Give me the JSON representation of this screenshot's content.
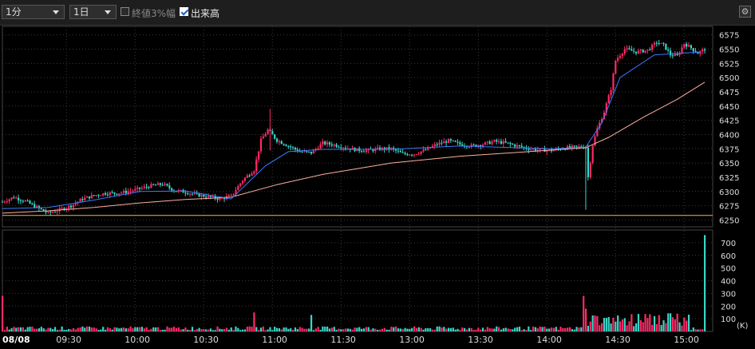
{
  "toolbar": {
    "interval": "1分",
    "period": "1日",
    "closing_pct_label": "終値3%幅",
    "closing_pct_checked": false,
    "volume_label": "出来高",
    "volume_checked": true,
    "settings_icon": "gear-icon"
  },
  "colors": {
    "up": "#ff2a66",
    "down": "#39d6c8",
    "ma_short": "#3a7bff",
    "ma_long": "#ffb0a0",
    "prev_close": "#e6b85a",
    "grid": "#3a3a3a",
    "background": "#000000"
  },
  "chart_data": [
    {
      "type": "candlestick",
      "date_label": "08/08",
      "x_ticks": [
        "09:30",
        "10:00",
        "10:30",
        "11:00",
        "11:30",
        "13:00",
        "13:30",
        "14:00",
        "14:30",
        "15:00"
      ],
      "y_ticks": [
        6250,
        6275,
        6300,
        6325,
        6350,
        6375,
        6400,
        6425,
        6450,
        6475,
        6500,
        6525,
        6550,
        6575
      ],
      "ylim": [
        6238,
        6590
      ],
      "prev_close": 6258,
      "series": [
        {
          "name": "price",
          "points": [
            [
              0,
              6282
            ],
            [
              5,
              6290
            ],
            [
              10,
              6283
            ],
            [
              15,
              6272
            ],
            [
              20,
              6262
            ],
            [
              25,
              6268
            ],
            [
              30,
              6275
            ],
            [
              35,
              6287
            ],
            [
              40,
              6293
            ],
            [
              45,
              6297
            ],
            [
              50,
              6297
            ],
            [
              55,
              6300
            ],
            [
              60,
              6305
            ],
            [
              65,
              6310
            ],
            [
              70,
              6313
            ],
            [
              75,
              6302
            ],
            [
              80,
              6299
            ],
            [
              85,
              6294
            ],
            [
              90,
              6291
            ],
            [
              95,
              6287
            ],
            [
              100,
              6292
            ],
            [
              105,
              6320
            ],
            [
              110,
              6338
            ],
            [
              113,
              6390
            ],
            [
              116,
              6408
            ],
            [
              120,
              6390
            ],
            [
              125,
              6380
            ],
            [
              130,
              6370
            ],
            [
              135,
              6368
            ],
            [
              140,
              6385
            ],
            [
              145,
              6382
            ],
            [
              150,
              6377
            ],
            [
              155,
              6373
            ],
            [
              160,
              6372
            ],
            [
              165,
              6375
            ],
            [
              170,
              6375
            ],
            [
              175,
              6366
            ],
            [
              180,
              6366
            ],
            [
              185,
              6373
            ],
            [
              190,
              6383
            ],
            [
              195,
              6389
            ],
            [
              200,
              6383
            ],
            [
              205,
              6380
            ],
            [
              210,
              6383
            ],
            [
              215,
              6388
            ],
            [
              220,
              6385
            ],
            [
              225,
              6380
            ],
            [
              230,
              6375
            ],
            [
              235,
              6373
            ],
            [
              240,
              6372
            ],
            [
              245,
              6376
            ],
            [
              250,
              6378
            ],
            [
              255,
              6378
            ],
            [
              256,
              6325
            ],
            [
              258,
              6382
            ],
            [
              260,
              6410
            ],
            [
              263,
              6440
            ],
            [
              266,
              6480
            ],
            [
              268,
              6530
            ],
            [
              272,
              6550
            ],
            [
              277,
              6545
            ],
            [
              282,
              6548
            ],
            [
              286,
              6562
            ],
            [
              289,
              6557
            ],
            [
              292,
              6540
            ],
            [
              295,
              6538
            ],
            [
              298,
              6560
            ],
            [
              301,
              6552
            ],
            [
              304,
              6543
            ],
            [
              307,
              6550
            ]
          ]
        },
        {
          "name": "ma_short",
          "points": [
            [
              0,
              6270
            ],
            [
              20,
              6272
            ],
            [
              40,
              6285
            ],
            [
              60,
              6300
            ],
            [
              80,
              6301
            ],
            [
              100,
              6287
            ],
            [
              115,
              6345
            ],
            [
              125,
              6370
            ],
            [
              140,
              6374
            ],
            [
              170,
              6374
            ],
            [
              200,
              6380
            ],
            [
              240,
              6375
            ],
            [
              255,
              6378
            ],
            [
              262,
              6420
            ],
            [
              270,
              6500
            ],
            [
              285,
              6540
            ],
            [
              305,
              6545
            ]
          ]
        },
        {
          "name": "ma_long",
          "points": [
            [
              0,
              6262
            ],
            [
              20,
              6266
            ],
            [
              40,
              6272
            ],
            [
              60,
              6280
            ],
            [
              80,
              6286
            ],
            [
              100,
              6290
            ],
            [
              120,
              6312
            ],
            [
              140,
              6330
            ],
            [
              170,
              6350
            ],
            [
              200,
              6362
            ],
            [
              230,
              6370
            ],
            [
              255,
              6377
            ],
            [
              265,
              6395
            ],
            [
              280,
              6430
            ],
            [
              295,
              6462
            ],
            [
              307,
              6492
            ]
          ]
        }
      ]
    },
    {
      "type": "bar",
      "unit_label": "(K)",
      "y_ticks": [
        100,
        200,
        300,
        400,
        500,
        600,
        700
      ],
      "ylim": [
        0,
        800
      ],
      "spikes": [
        [
          0,
          280
        ],
        [
          110,
          150
        ],
        [
          135,
          130
        ],
        [
          254,
          280
        ],
        [
          255,
          180
        ],
        [
          307,
          760
        ]
      ],
      "base_level": 25
    }
  ]
}
